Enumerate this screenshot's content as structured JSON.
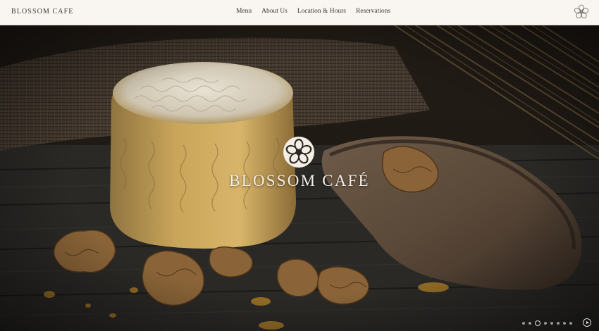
{
  "header": {
    "brand": "BLOSSOM CAFE",
    "nav": [
      "Menu",
      "About Us",
      "Location & Hours",
      "Reservations"
    ]
  },
  "hero": {
    "title": "BLOSSOM CAFÉ",
    "slide_count": 8,
    "active_slide": 3
  },
  "colors": {
    "header_bg": "#f9f6f1",
    "text_dark": "#3b3631",
    "hero_text": "#f3eee6"
  }
}
